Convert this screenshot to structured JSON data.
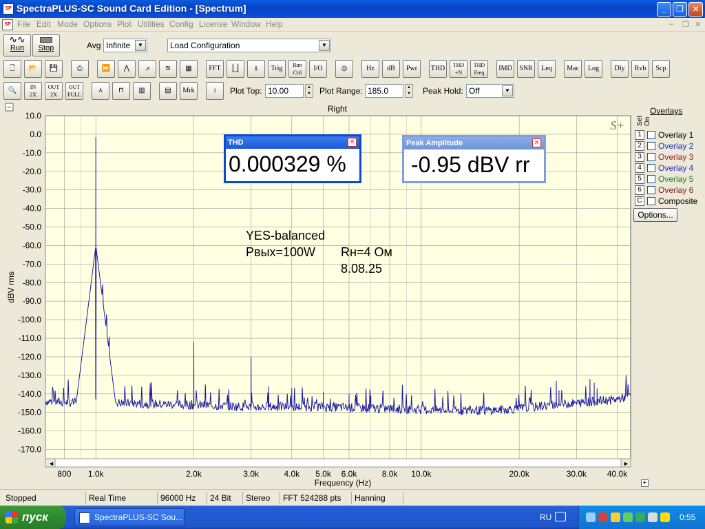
{
  "window": {
    "title": "SpectraPLUS-SC Sound Card Edition - [Spectrum]",
    "app_icon": "spectra-icon"
  },
  "menu": {
    "items": [
      "File",
      "Edit",
      "Mode",
      "Options",
      "Plot",
      "Utilities",
      "Config",
      "License",
      "Window",
      "Help"
    ]
  },
  "toolbar1": {
    "run_label": "Run",
    "stop_label": "Stop",
    "avg_label": "Avg",
    "avg_value": "Infinite",
    "config_value": "Load Configuration"
  },
  "toolbar2": {
    "buttons": [
      "FFT",
      "Trig",
      "Run Ctrl",
      "I/O",
      "Hz",
      "dB",
      "Pwr",
      "THD",
      "THD +N",
      "THD Freq",
      "IMD",
      "SNR",
      "Leq",
      "Mac",
      "Log",
      "Dly",
      "Rvb",
      "Scp"
    ]
  },
  "toolbar3": {
    "mrk_label": "Mrk",
    "plot_top_label": "Plot Top:",
    "plot_top_value": "10.00",
    "plot_range_label": "Plot Range:",
    "plot_range_value": "185.0",
    "peak_hold_label": "Peak Hold:",
    "peak_hold_value": "Off"
  },
  "plot": {
    "channel": "Right",
    "logo": "S+"
  },
  "chart_data": {
    "type": "line",
    "xlabel": "Frequency (Hz)",
    "ylabel": "dBV rms",
    "x_scale": "log",
    "xlim": [
      700,
      44000
    ],
    "ylim": [
      -175,
      10
    ],
    "x_tick_values": [
      800,
      1000,
      2000,
      3000,
      4000,
      5000,
      6000,
      8000,
      10000,
      20000,
      30000,
      40000
    ],
    "x_tick_labels": [
      "800",
      "1.0k",
      "2.0k",
      "3.0k",
      "4.0k",
      "5.0k",
      "6.0k",
      "8.0k",
      "10.0k",
      "20.0k",
      "30.0k",
      "40.0k"
    ],
    "y_ticks": [
      10,
      0,
      -10,
      -20,
      -30,
      -40,
      -50,
      -60,
      -70,
      -80,
      -90,
      -100,
      -110,
      -120,
      -130,
      -140,
      -150,
      -160,
      -170
    ],
    "y_tick_labels": [
      "10.0",
      "0.0",
      "-10.0",
      "-20.0",
      "-30.0",
      "-40.0",
      "-50.0",
      "-60.0",
      "-70.0",
      "-80.0",
      "-90.0",
      "-100.0",
      "-110.0",
      "-120.0",
      "-130.0",
      "-140.0",
      "-150.0",
      "-160.0",
      "-170.0"
    ],
    "grid": true,
    "series": [
      {
        "color": "#1a1aa8",
        "noise_floor": [
          [
            700,
            -144
          ],
          [
            900,
            -145
          ],
          [
            1000,
            -143
          ],
          [
            1200,
            -145
          ],
          [
            2000,
            -146
          ],
          [
            3000,
            -147
          ],
          [
            5000,
            -147
          ],
          [
            8000,
            -148
          ],
          [
            12000,
            -149
          ],
          [
            16000,
            -149
          ],
          [
            20000,
            -148
          ],
          [
            25000,
            -146
          ],
          [
            30000,
            -145
          ],
          [
            40000,
            -143
          ],
          [
            44000,
            -141
          ]
        ],
        "peaks": [
          [
            1000,
            -1.5
          ],
          [
            2000,
            -112
          ],
          [
            3000,
            -120
          ],
          [
            3400,
            -136
          ],
          [
            4000,
            -137
          ],
          [
            5000,
            -139
          ],
          [
            6000,
            -140
          ],
          [
            7000,
            -141
          ],
          [
            26000,
            -133
          ],
          [
            26500,
            -138
          ],
          [
            33000,
            -132
          ],
          [
            34000,
            -134
          ],
          [
            34700,
            -137
          ]
        ]
      }
    ]
  },
  "overlays": {
    "title": "Overlays",
    "set_on_label": "Set On",
    "items": [
      {
        "num": "1",
        "name": "Overlay 1",
        "color": "#000000"
      },
      {
        "num": "2",
        "name": "Overlay 2",
        "color": "#2030c0"
      },
      {
        "num": "3",
        "name": "Overlay 3",
        "color": "#9a2020"
      },
      {
        "num": "4",
        "name": "Overlay 4",
        "color": "#2030c0"
      },
      {
        "num": "5",
        "name": "Overlay 5",
        "color": "#208020"
      },
      {
        "num": "6",
        "name": "Overlay 6",
        "color": "#802020"
      },
      {
        "num": "C",
        "name": "Composite",
        "color": "#000000"
      }
    ],
    "options_label": "Options..."
  },
  "meters": {
    "thd": {
      "title": "THD",
      "value": "0.000329 %"
    },
    "peak": {
      "title": "Peak Amplitude",
      "value": "-0.95 dBV rr"
    }
  },
  "annotations": {
    "line1": "YES-balanced",
    "line2": "Pвых=100W",
    "line3": "Rн=4 Ом",
    "line4": "8.08.25"
  },
  "status": {
    "state": "Stopped",
    "mode": "Real Time",
    "rate": "96000 Hz",
    "bits": "24 Bit",
    "channels": "Stereo",
    "fft": "FFT 524288 pts",
    "window": "Hanning"
  },
  "taskbar": {
    "start_label": "пуск",
    "task_label": "SpectraPLUS-SC Sou...",
    "lang": "RU",
    "clock": "0:55"
  }
}
